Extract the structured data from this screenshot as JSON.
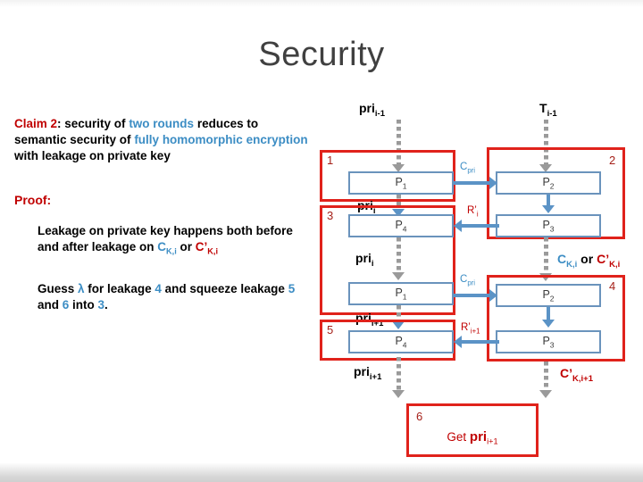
{
  "slide": {
    "title": "Security"
  },
  "left_column": {
    "claim": {
      "label": "Claim 2",
      "colon": ":",
      "part1": " security of ",
      "highlight1": "two rounds",
      "part2": " reduces to semantic security of ",
      "highlight2": "fully homomorphic encryption",
      "part3": " with leakage on private key"
    },
    "proof_label": "Proof:",
    "leakage_text": {
      "part1": "Leakage on private key happens both before and after leakage on ",
      "sym_blue": "C",
      "sym_blue_sub": "K,i",
      "middle": " or ",
      "sym_red": "C’",
      "sym_red_sub": "K,i"
    },
    "guess_text": {
      "part1": "Guess ",
      "lambda": "λ",
      "part2": " for leakage ",
      "n4": "4",
      "part3": " and squeeze leakage ",
      "n5": "5",
      "part4": " and ",
      "n6": "6",
      "part5": " into ",
      "n3": "3",
      "part6": "."
    }
  },
  "diagram": {
    "top_inputs": {
      "pri_prev": {
        "base": "pri",
        "sub": "i-1"
      },
      "t_prev": {
        "base": "T",
        "sub": "i-1"
      }
    },
    "boxes": {
      "b1": "1",
      "b2": "2",
      "b3": "3",
      "b4": "4",
      "b5": "5",
      "b6": "6"
    },
    "parties": {
      "p1": {
        "base": "P",
        "sub": "1"
      },
      "p2": {
        "base": "P",
        "sub": "2"
      },
      "p3": {
        "base": "P",
        "sub": "3"
      },
      "p4": {
        "base": "P",
        "sub": "4"
      }
    },
    "edge_labels": {
      "cpri_top": {
        "base": "C",
        "sub": "pri"
      },
      "cpri_mid": {
        "base": "C",
        "sub": "pri"
      },
      "r_i": {
        "base": "R’",
        "sub": "i"
      },
      "r_i1": {
        "base": "R’",
        "sub": "i+1"
      },
      "pri_i_a": {
        "base": "pri",
        "sub": "i"
      },
      "pri_i_b": {
        "base": "pri",
        "sub": "i"
      },
      "pri_i1_a": {
        "base": "pri",
        "sub": "i+1"
      },
      "pri_i1_b": {
        "base": "pri",
        "sub": "i+1"
      },
      "ck_or": {
        "blue": "C",
        "blue_sub": "K,i",
        "mid": " or ",
        "red": "C’",
        "red_sub": "K,i"
      },
      "ck_next": {
        "base": "C’",
        "sub": "K,i+1"
      }
    },
    "final_box": {
      "prefix": "Get ",
      "base": "pri",
      "sub": "i+1"
    }
  },
  "colors": {
    "title": "#404040",
    "red": "#C00000",
    "box_red": "#E0221B",
    "blue": "#3C8DC4",
    "party_blue": "#6A93BC",
    "arrow_blue": "#5B93C6",
    "dotted_grey": "#9A9A9A"
  }
}
